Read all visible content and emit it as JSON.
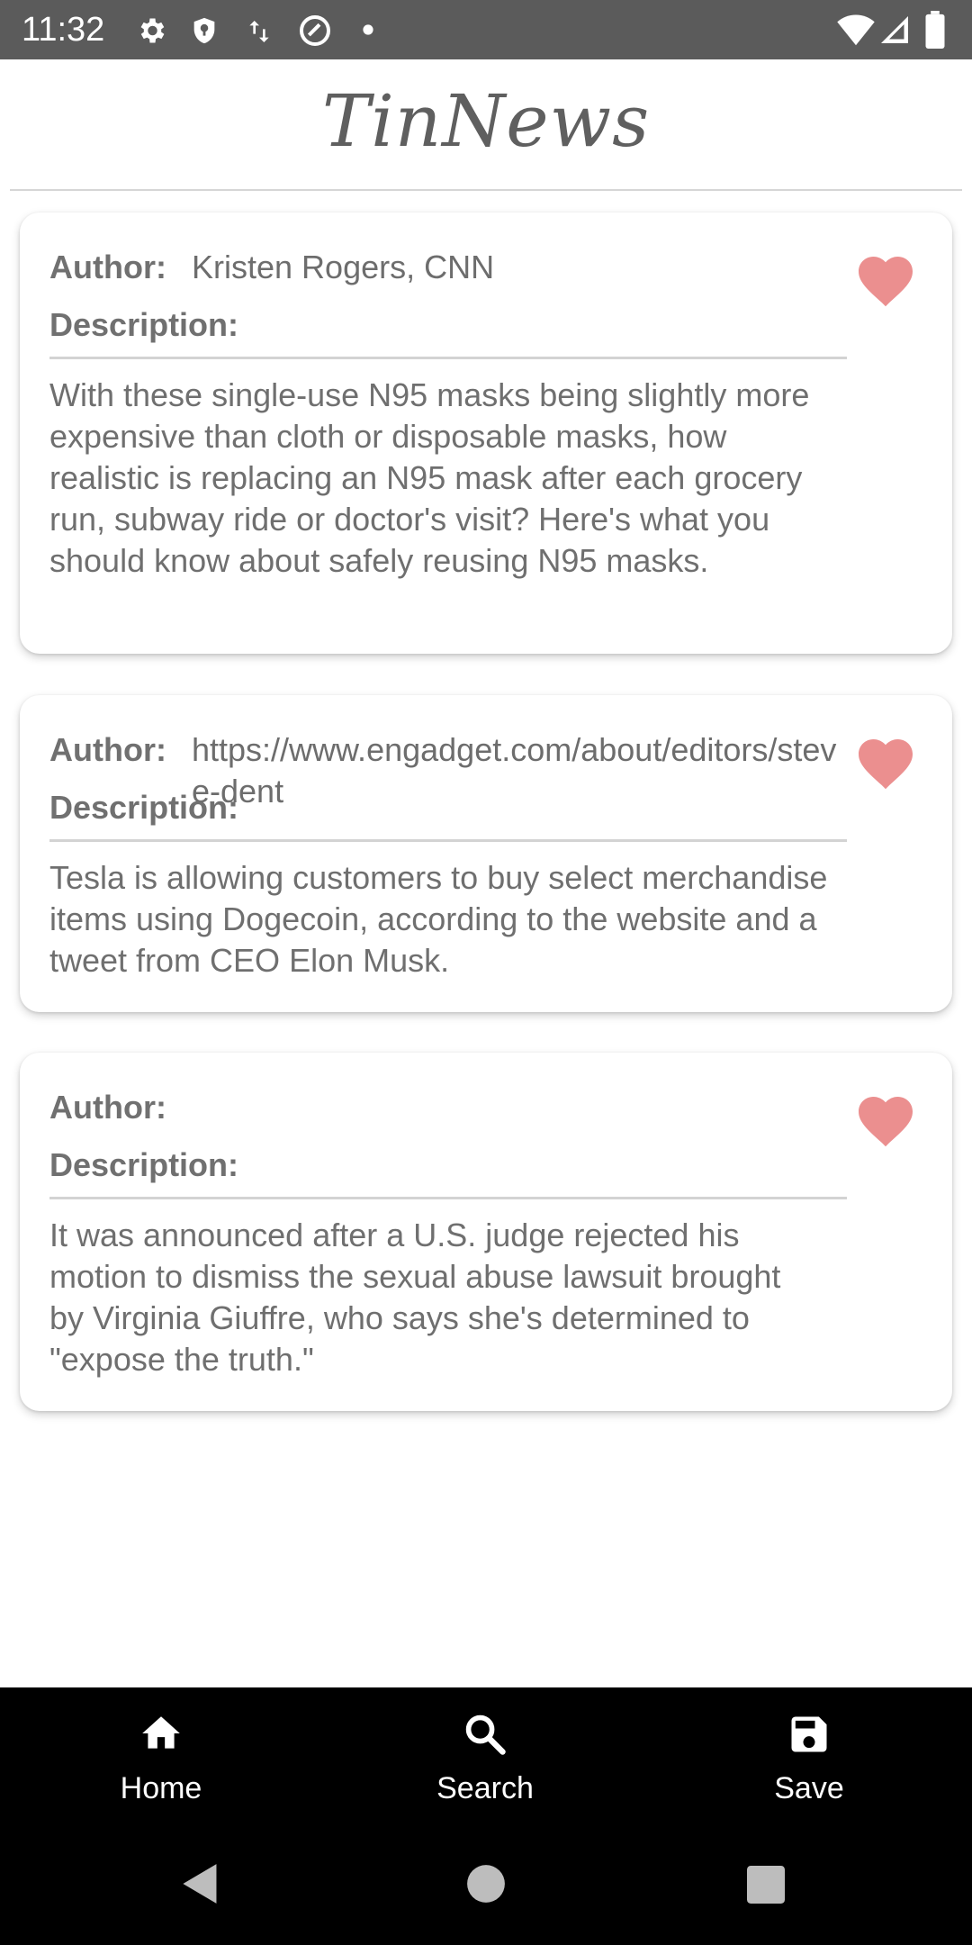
{
  "status_bar": {
    "time": "11:32",
    "left_icons": [
      "gear-icon",
      "shield-icon",
      "data-transfer-icon",
      "at-sign-icon",
      "dot-icon"
    ],
    "right_icons": [
      "wifi-icon",
      "cell-signal-icon",
      "battery-icon"
    ]
  },
  "header": {
    "title": "TinNews"
  },
  "labels": {
    "author": "Author:",
    "description": "Description:"
  },
  "articles": [
    {
      "author": "Kristen Rogers, CNN",
      "description": "With these single-use N95 masks being slightly more expensive than cloth or disposable masks, how realistic is replacing an N95 mask after each grocery run, subway ride or doctor's visit? Here's what you should know about safely reusing N95 masks.",
      "favorite_icon": "heart-icon"
    },
    {
      "author": "https://www.engadget.com/about/editors/steve-dent",
      "description": "Tesla is allowing customers to buy select merchandise items using Dogecoin, according to the website and a tweet from CEO Elon Musk.",
      "favorite_icon": "heart-icon"
    },
    {
      "author": "",
      "description": "It was announced after a U.S. judge rejected his motion to dismiss the sexual abuse lawsuit brought by Virginia Giuffre, who says she's determined to \"expose the truth.\"",
      "favorite_icon": "heart-icon"
    }
  ],
  "bottom_nav": {
    "items": [
      {
        "label": "Home",
        "icon": "home-icon"
      },
      {
        "label": "Search",
        "icon": "search-icon"
      },
      {
        "label": "Save",
        "icon": "save-icon"
      }
    ]
  },
  "colors": {
    "heart": "#eb8f8f",
    "status_bar": "#5b5b5b",
    "nav_background": "#000000",
    "text": "#6f6f6f"
  }
}
